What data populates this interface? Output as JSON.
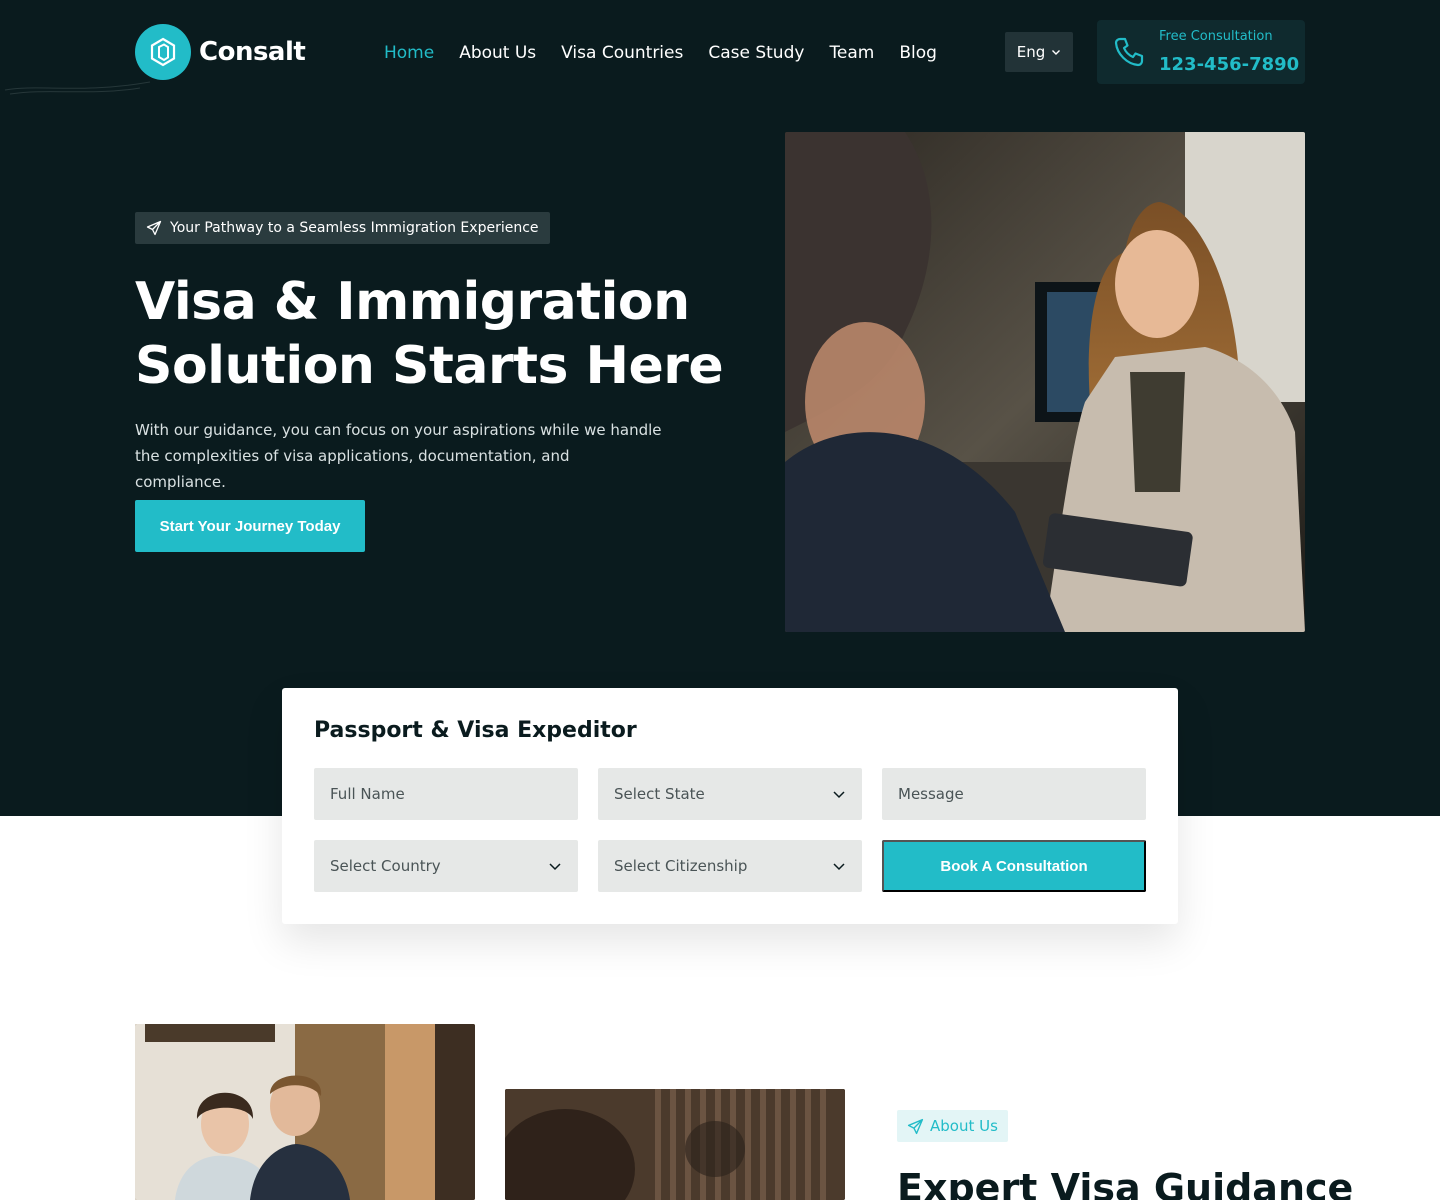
{
  "brand": {
    "name": "Consalt"
  },
  "nav": {
    "items": [
      {
        "label": "Home",
        "active": true
      },
      {
        "label": "About Us"
      },
      {
        "label": "Visa Countries"
      },
      {
        "label": "Case Study"
      },
      {
        "label": "Team"
      },
      {
        "label": "Blog"
      }
    ]
  },
  "language": {
    "selected": "Eng"
  },
  "contact": {
    "label": "Free Consultation",
    "phone": "123-456-7890"
  },
  "hero": {
    "badge": "Your Pathway to a Seamless Immigration Experience",
    "title_line1": "Visa & Immigration",
    "title_line2": "Solution Starts Here",
    "description": "With our guidance, you can focus on your aspirations while we handle the complexities of visa applications, documentation, and compliance.",
    "cta": "Start Your Journey Today"
  },
  "form": {
    "title": "Passport & Visa Expeditor",
    "full_name_placeholder": "Full Name",
    "state_placeholder": "Select State",
    "message_placeholder": "Message",
    "country_placeholder": "Select Country",
    "citizenship_placeholder": "Select Citizenship",
    "submit": "Book A Consultation"
  },
  "about": {
    "badge": "About Us",
    "title": "Expert Visa Guidance"
  },
  "colors": {
    "accent": "#22bcc8",
    "dark": "#0a1b1e"
  }
}
